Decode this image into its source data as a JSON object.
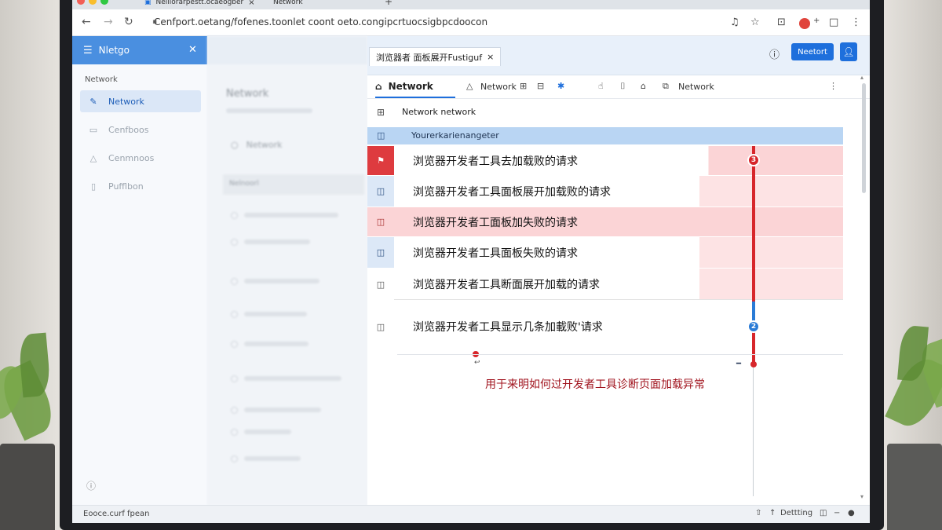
{
  "browser": {
    "tabs": [
      {
        "label": "Nelliorarpestt.ocaeogber",
        "close": "×"
      },
      {
        "label": "Network"
      }
    ],
    "new_tab_glyph": "+",
    "url": "Cenfport.oetang/fofenes.toonlet coont oeto.congipcrtuocsigbpcdoocon",
    "traffic_colors": [
      "#f25f57",
      "#f9be2e",
      "#30c842"
    ]
  },
  "sidebar": {
    "header_label": "Nletgo",
    "section_label": "Network",
    "items": [
      {
        "label": "Network",
        "active": true
      },
      {
        "label": "Cenfboos",
        "active": false
      },
      {
        "label": "Cenmnoos",
        "active": false
      },
      {
        "label": "Pufflbon",
        "active": false
      }
    ]
  },
  "middle_pane": {
    "title": "Network",
    "link": "Network",
    "band_label": "Nelnoorl"
  },
  "devtools": {
    "file_tab_label": "浏览器者 面板展开Fustiguf",
    "file_tab_close": "×",
    "network_button": "Neetort",
    "toolbar": {
      "main_tab": "Network",
      "second_label": "Network",
      "third_label": "Network"
    },
    "breadcrumb": "Network network",
    "header_row": "Yourerkarienangeter",
    "requests": [
      {
        "label": "浏览器开发者工具去加载败的请求"
      },
      {
        "label": "浏览器开发者工具面板展开加载败的请求"
      },
      {
        "label": "浏览器开发者工面板加失败的请求"
      },
      {
        "label": "浏览器开发者工具面板失败的请求"
      },
      {
        "label": "浏览器开发者工具断面展开加载的请求"
      },
      {
        "label": "浏览器开发者工具显示几条加載败'请求"
      }
    ],
    "waterfall_badges": {
      "error_count": "3",
      "info_count": "2"
    },
    "message": "用于来明如何过开发者工具诊断页面加载异常",
    "colors": {
      "accent": "#1e6fdc",
      "error": "#d7262b",
      "error_row": "#fbd4d6",
      "info_row": "#dce8f7"
    }
  },
  "status": {
    "left_text": "Eooce.curf fpean",
    "right_label": "Dettting"
  }
}
